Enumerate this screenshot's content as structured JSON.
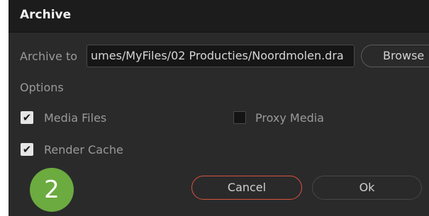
{
  "dialog": {
    "title": "Archive",
    "archive_to_label": "Archive to",
    "archive_path": "umes/MyFiles/02 Producties/Noordmolen.dra",
    "browse_label": "Browse",
    "options_label": "Options",
    "options": [
      {
        "label": "Media Files",
        "checked": true
      },
      {
        "label": "Proxy Media",
        "checked": false
      },
      {
        "label": "Render Cache",
        "checked": true
      }
    ],
    "cancel_label": "Cancel",
    "ok_label": "Ok"
  },
  "overlay": {
    "step_number": "2"
  },
  "colors": {
    "cancel_border": "#d9533b",
    "step_badge": "#6cab3f"
  }
}
